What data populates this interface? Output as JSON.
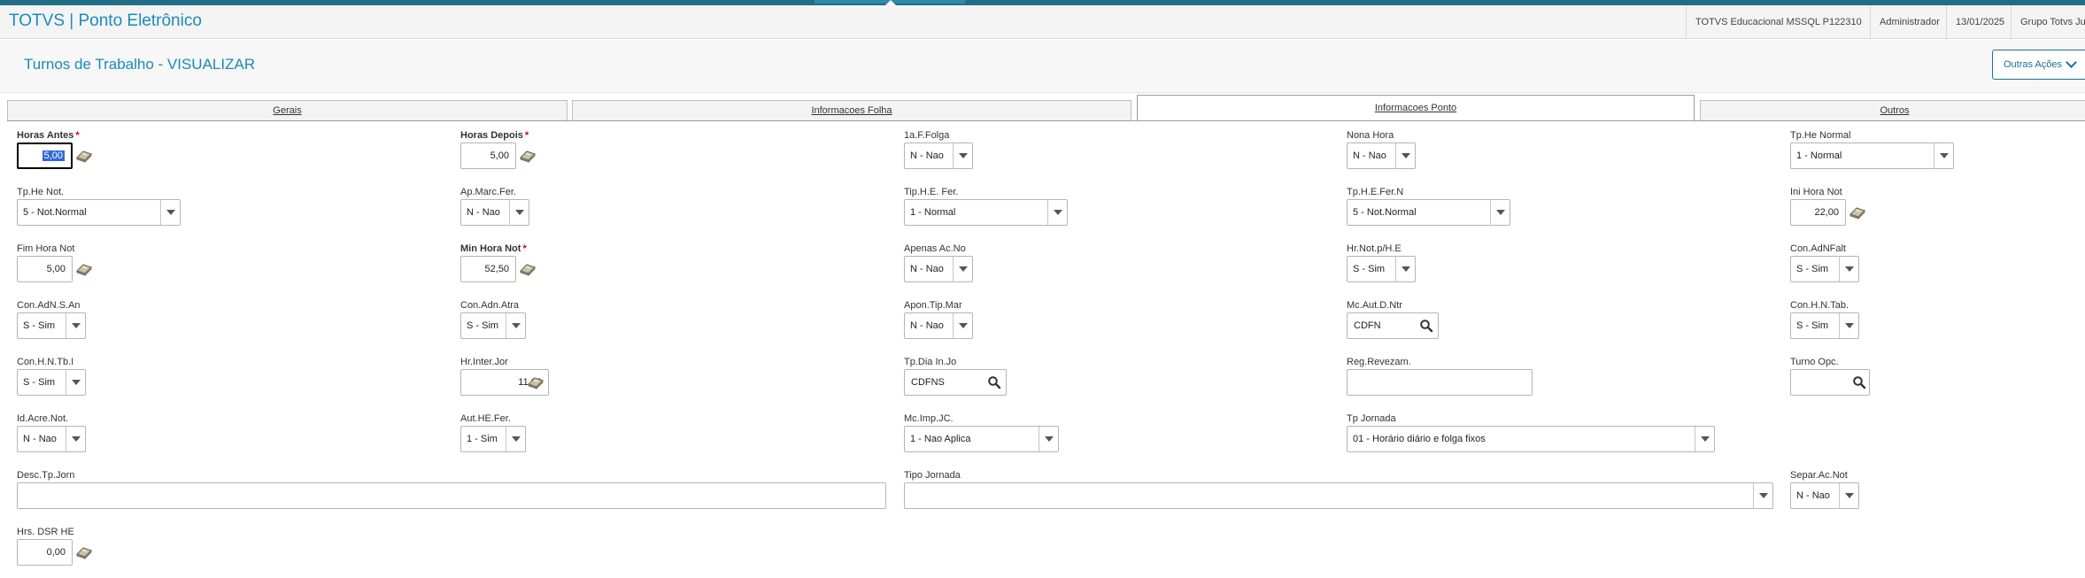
{
  "app": {
    "title": "TOTVS | Ponto Eletrônico",
    "environment": "TOTVS Educacional MSSQL P122310",
    "user": "Administrador",
    "date": "13/01/2025",
    "group": "Grupo Totvs Ju"
  },
  "page": {
    "title": "Turnos de Trabalho - VISUALIZAR",
    "actions_label": "Outras Ações"
  },
  "tabs": [
    {
      "label": "Gerais"
    },
    {
      "label": "Informacoes Folha"
    },
    {
      "label": "Informacoes Ponto"
    },
    {
      "label": "Outros"
    }
  ],
  "fields": {
    "horas_antes": {
      "label": "Horas Antes",
      "value": "5,00"
    },
    "horas_depois": {
      "label": "Horas Depois",
      "value": "5,00"
    },
    "folga": {
      "label": "1a.F.Folga",
      "value": "N - Nao"
    },
    "nona_hora": {
      "label": "Nona Hora",
      "value": "N - Nao"
    },
    "tp_he_normal": {
      "label": "Tp.He Normal",
      "value": "1 - Normal"
    },
    "tp_he_not": {
      "label": "Tp.He Not.",
      "value": "5 - Not.Normal"
    },
    "ap_marc_fer": {
      "label": "Ap.Marc.Fer.",
      "value": "N - Nao"
    },
    "tip_he_fer": {
      "label": "Tip.H.E. Fer.",
      "value": "1 - Normal"
    },
    "tp_he_fer_n": {
      "label": "Tp.H.E.Fer.N",
      "value": "5 - Not.Normal"
    },
    "ini_hora_not": {
      "label": "Ini Hora Not",
      "value": "22,00"
    },
    "fim_hora_not": {
      "label": "Fim Hora Not",
      "value": "5,00"
    },
    "min_hora_not": {
      "label": "Min Hora Not",
      "value": "52,50"
    },
    "apenas_ac_no": {
      "label": "Apenas Ac.No",
      "value": "N - Nao"
    },
    "hr_not_p_he": {
      "label": "Hr.Not.p/H.E",
      "value": "S - Sim"
    },
    "con_adnfalt": {
      "label": "Con.AdNFalt",
      "value": "S - Sim"
    },
    "con_adn_s_an": {
      "label": "Con.AdN.S.An",
      "value": "S - Sim"
    },
    "con_adn_atra": {
      "label": "Con.Adn.Atra",
      "value": "S - Sim"
    },
    "apon_tip_mar": {
      "label": "Apon.Tip.Mar",
      "value": "N - Nao"
    },
    "mc_aut_d_ntr": {
      "label": "Mc.Aut.D.Ntr",
      "value": "CDFN"
    },
    "con_h_n_tab": {
      "label": "Con.H.N.Tab.",
      "value": "S - Sim"
    },
    "con_h_n_tb_i": {
      "label": "Con.H.N.Tb.I",
      "value": "S - Sim"
    },
    "hr_inter_jor": {
      "label": "Hr.Inter.Jor",
      "value": "11,00"
    },
    "tp_dia_in_jo": {
      "label": "Tp.Dia In.Jo",
      "value": "CDFNS"
    },
    "reg_revezam": {
      "label": "Reg.Revezam.",
      "value": ""
    },
    "turno_opc": {
      "label": "Turno Opc.",
      "value": ""
    },
    "id_acre_not": {
      "label": "Id.Acre.Not.",
      "value": "N - Nao"
    },
    "aut_he_fer": {
      "label": "Aut.HE.Fer.",
      "value": "1 - Sim"
    },
    "mc_imp_jc": {
      "label": "Mc.Imp.JC.",
      "value": "1 - Nao Aplica"
    },
    "tp_jornada": {
      "label": "Tp Jornada",
      "value": "01 - Horário diário e folga fixos"
    },
    "desc_tp_jorn": {
      "label": "Desc.Tp.Jorn",
      "value": ""
    },
    "tipo_jornada": {
      "label": "Tipo Jornada",
      "value": ""
    },
    "separ_ac_not": {
      "label": "Separ.Ac.Not",
      "value": "N - Nao"
    },
    "hrs_dsr_he": {
      "label": "Hrs. DSR HE",
      "value": "0,00"
    }
  },
  "colors": {
    "brand": "#1a8bb7",
    "topbar": "#1f6e86",
    "required": "#d40000",
    "selection": "#2f6bd6"
  }
}
